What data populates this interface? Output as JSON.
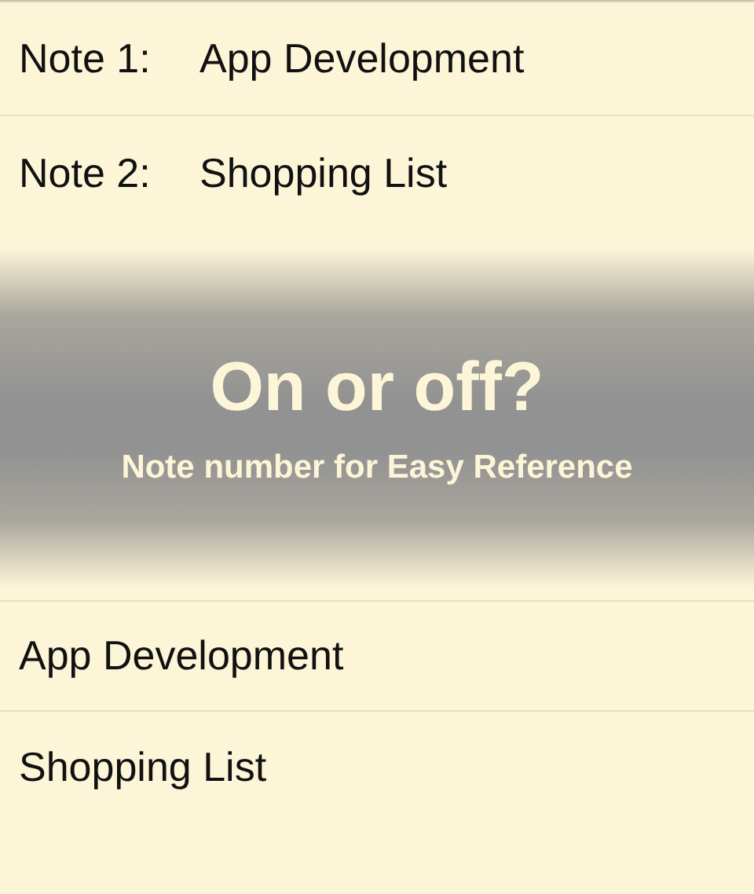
{
  "numbered_notes": [
    {
      "number": "Note 1:",
      "title": "App Development"
    },
    {
      "number": "Note 2:",
      "title": "Shopping List"
    }
  ],
  "banner": {
    "title": "On or off?",
    "subtitle": "Note number for Easy Reference"
  },
  "notes": [
    {
      "title": "App Development"
    },
    {
      "title": "Shopping List"
    }
  ]
}
